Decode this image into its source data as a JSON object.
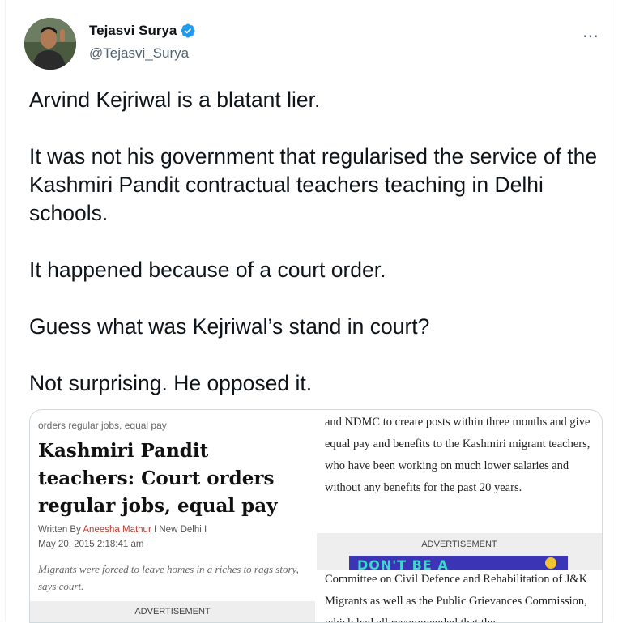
{
  "author": {
    "name": "Tejasvi Surya",
    "handle": "@Tejasvi_Surya",
    "verified": true
  },
  "more_icon": "⋯",
  "tweet": {
    "paragraphs": [
      "Arvind Kejriwal is a blatant lier.",
      "It was not his government that regularised the service of the Kashmiri Pandit contractual teachers teaching in Delhi schools.",
      "It happened because of a court order.",
      "Guess what was Kejriwal’s stand in court?",
      "Not surprising. He opposed it."
    ]
  },
  "media": {
    "left": {
      "crumb": "orders regular jobs, equal pay",
      "headline": "Kashmiri Pandit teachers: Court orders regular jobs, equal pay",
      "byline_prefix": "Written By ",
      "byline_author": "Aneesha Mathur",
      "byline_suffix": " I New Delhi I",
      "date": "May 20, 2015 2:18:41 am",
      "caption": "Migrants were forced to leave homes in a riches to rags story, says court.",
      "ad_label": "ADVERTISEMENT"
    },
    "right": {
      "body_top": "and NDMC to create posts within three months and give equal pay and benefits to the Kashmiri migrant teachers, who have been working on much lower salaries and without any benefits for the past 20 years.",
      "ad_label": "ADVERTISEMENT",
      "banner_text": "DON'T BE A",
      "body_bottom": "Committee on Civil Defence and Rehabilitation of J&K Migrants as well as the Public Grievances Commission, which had all recommended that the"
    }
  },
  "colors": {
    "verified_badge": "#1d9bf0",
    "text_primary": "#0f1419",
    "text_secondary": "#536471",
    "byline_author": "#c0392b"
  }
}
